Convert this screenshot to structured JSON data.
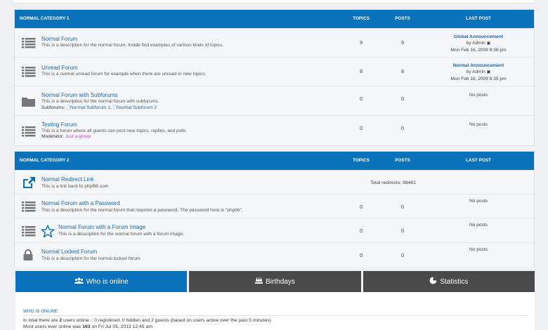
{
  "colors": {
    "accent": "#0a72bb",
    "inactive_tab": "#4a4a4a",
    "link": "#1a66a8",
    "group": "#c03fb7"
  },
  "categories": [
    {
      "name": "NORMAL CATEGORY 1",
      "col_topics": "TOPICS",
      "col_posts": "POSTS",
      "col_last": "LAST POST",
      "forums": [
        {
          "icon": "list-icon",
          "title": "Normal Forum",
          "desc": "This is a description for the normal forum. Inside find examples of various kinds of topics.",
          "topics": "9",
          "posts": "9",
          "last_title": "Global Announcement",
          "last_by": "by Admin",
          "last_date": "Mon Feb 16, 2009 8:36 pm"
        },
        {
          "icon": "list-icon",
          "title": "Unread Forum",
          "desc": "This is a normal unread forum for example when there are unread or new topics.",
          "topics": "8",
          "posts": "8",
          "last_title": "Normal Announcement",
          "last_by": "by Admin",
          "last_date": "Mon Feb 16, 2009 8:35 pm"
        },
        {
          "icon": "folder-icon",
          "title": "Normal Forum with Subforums",
          "desc": "This is a description for the normal forum with subforums.",
          "extra_label": "Subforums:",
          "sub1": "Normal Subforum 1",
          "sub2": "Normal Subforum 2",
          "topics": "0",
          "posts": "0",
          "last_none": "No posts"
        },
        {
          "icon": "list-icon",
          "title": "Testing Forum",
          "desc": "This is a forum where all guests can post new topics, replies, and polls.",
          "extra_label": "Moderator:",
          "moderator": "Just a group",
          "topics": "0",
          "posts": "0",
          "last_none": "No posts"
        }
      ]
    },
    {
      "name": "NORMAL CATEGORY 2",
      "col_topics": "TOPICS",
      "col_posts": "POSTS",
      "col_last": "LAST POST",
      "forums": [
        {
          "icon": "external-link-icon",
          "title": "Normal Redirect Link",
          "desc": "This is a link back to phpBB.com",
          "redirects": "Total redirects: 98481"
        },
        {
          "icon": "list-icon",
          "title": "Normal Forum with a Password",
          "desc": "This is a description for the normal forum that requires a password. The password here is \"phpbb\".",
          "topics": "0",
          "posts": "0",
          "last_none": "No posts"
        },
        {
          "icon": "list-icon",
          "title": "Normal Forum with a Forum Image",
          "desc": "This is a description for the normal forum with a forum image.",
          "topics": "0",
          "posts": "0",
          "last_none": "No posts"
        },
        {
          "icon": "lock-icon",
          "title": "Normal Locked Forum",
          "desc": "This is a description for the normal locked forum.",
          "topics": "0",
          "posts": "0",
          "last_none": "No posts"
        }
      ]
    }
  ],
  "tabs": [
    {
      "icon": "users-icon",
      "label": "Who is online",
      "active": true
    },
    {
      "icon": "cake-icon",
      "label": "Birthdays",
      "active": false
    },
    {
      "icon": "pie-chart-icon",
      "label": "Statistics",
      "active": false
    }
  ],
  "online": {
    "heading": "WHO IS ONLINE",
    "line1_a": "In total there are ",
    "line1_count": "2",
    "line1_b": " users online :: 0 registered, 0 hidden and 2 guests (based on users active over the past 5 minutes)",
    "line2_a": "Most users ever online was ",
    "line2_count": "163",
    "line2_b": " on Fri Jul 05, 2013 12:45 am"
  }
}
